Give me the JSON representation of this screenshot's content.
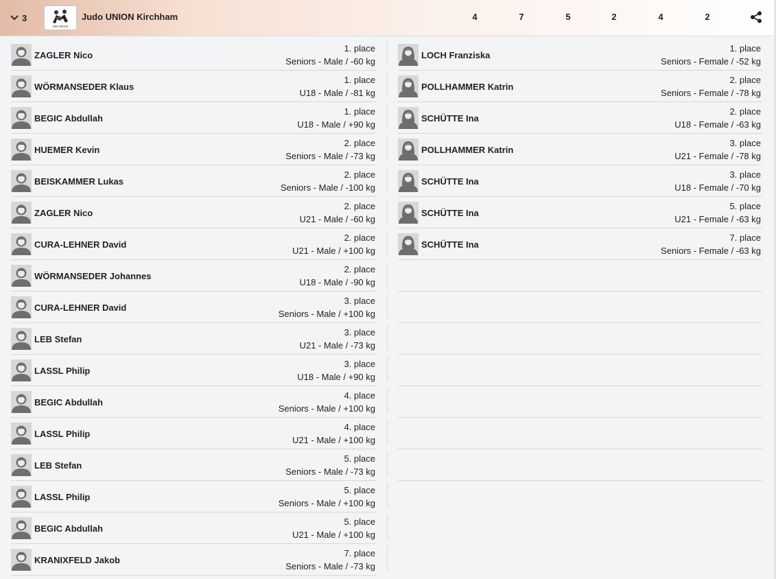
{
  "header": {
    "rank": "3",
    "club_name": "Judo UNION Kirchham",
    "logo_text": "KIRCHHAM",
    "stats": [
      "4",
      "7",
      "5",
      "2",
      "4",
      "2"
    ]
  },
  "left": [
    {
      "name": "ZAGLER Nico",
      "place": "1. place",
      "category": "Seniors - Male / -60 kg"
    },
    {
      "name": "WÖRMANSEDER Klaus",
      "place": "1. place",
      "category": "U18 - Male / -81 kg"
    },
    {
      "name": "BEGIC Abdullah",
      "place": "1. place",
      "category": "U18 - Male / +90 kg"
    },
    {
      "name": "HUEMER Kevin",
      "place": "2. place",
      "category": "Seniors - Male / -73 kg"
    },
    {
      "name": "BEISKAMMER Lukas",
      "place": "2. place",
      "category": "Seniors - Male / -100 kg"
    },
    {
      "name": "ZAGLER Nico",
      "place": "2. place",
      "category": "U21 - Male / -60 kg"
    },
    {
      "name": "CURA-LEHNER David",
      "place": "2. place",
      "category": "U21 - Male / +100 kg"
    },
    {
      "name": "WÖRMANSEDER Johannes",
      "place": "2. place",
      "category": "U18 - Male / -90 kg"
    },
    {
      "name": "CURA-LEHNER David",
      "place": "3. place",
      "category": "Seniors - Male / +100 kg"
    },
    {
      "name": "LEB Stefan",
      "place": "3. place",
      "category": "U21 - Male / -73 kg"
    },
    {
      "name": "LASSL Philip",
      "place": "3. place",
      "category": "U18 - Male / +90 kg"
    },
    {
      "name": "BEGIC Abdullah",
      "place": "4. place",
      "category": "Seniors - Male / +100 kg"
    },
    {
      "name": "LASSL Philip",
      "place": "4. place",
      "category": "U21 - Male / +100 kg"
    },
    {
      "name": "LEB Stefan",
      "place": "5. place",
      "category": "Seniors - Male / -73 kg"
    },
    {
      "name": "LASSL Philip",
      "place": "5. place",
      "category": "Seniors - Male / +100 kg"
    },
    {
      "name": "BEGIC Abdullah",
      "place": "5. place",
      "category": "U21 - Male / +100 kg"
    },
    {
      "name": "KRANIXFELD Jakob",
      "place": "7. place",
      "category": "Seniors - Male / -73 kg"
    }
  ],
  "right": [
    {
      "name": "LOCH Franziska",
      "place": "1. place",
      "category": "Seniors - Female / -52 kg"
    },
    {
      "name": "POLLHAMMER Katrin",
      "place": "2. place",
      "category": "Seniors - Female / -78 kg"
    },
    {
      "name": "SCHÜTTE Ina",
      "place": "2. place",
      "category": "U18 - Female / -63 kg"
    },
    {
      "name": "POLLHAMMER Katrin",
      "place": "3. place",
      "category": "U21 - Female / -78 kg"
    },
    {
      "name": "SCHÜTTE Ina",
      "place": "3. place",
      "category": "U18 - Female / -70 kg"
    },
    {
      "name": "SCHÜTTE Ina",
      "place": "5. place",
      "category": "U21 - Female / -63 kg"
    },
    {
      "name": "SCHÜTTE Ina",
      "place": "7. place",
      "category": "Seniors - Female / -63 kg"
    }
  ],
  "icons": {
    "collapse": "chevron-down-icon",
    "share": "share-icon",
    "avatar_male": "male-avatar-icon",
    "avatar_female": "female-avatar-icon"
  }
}
